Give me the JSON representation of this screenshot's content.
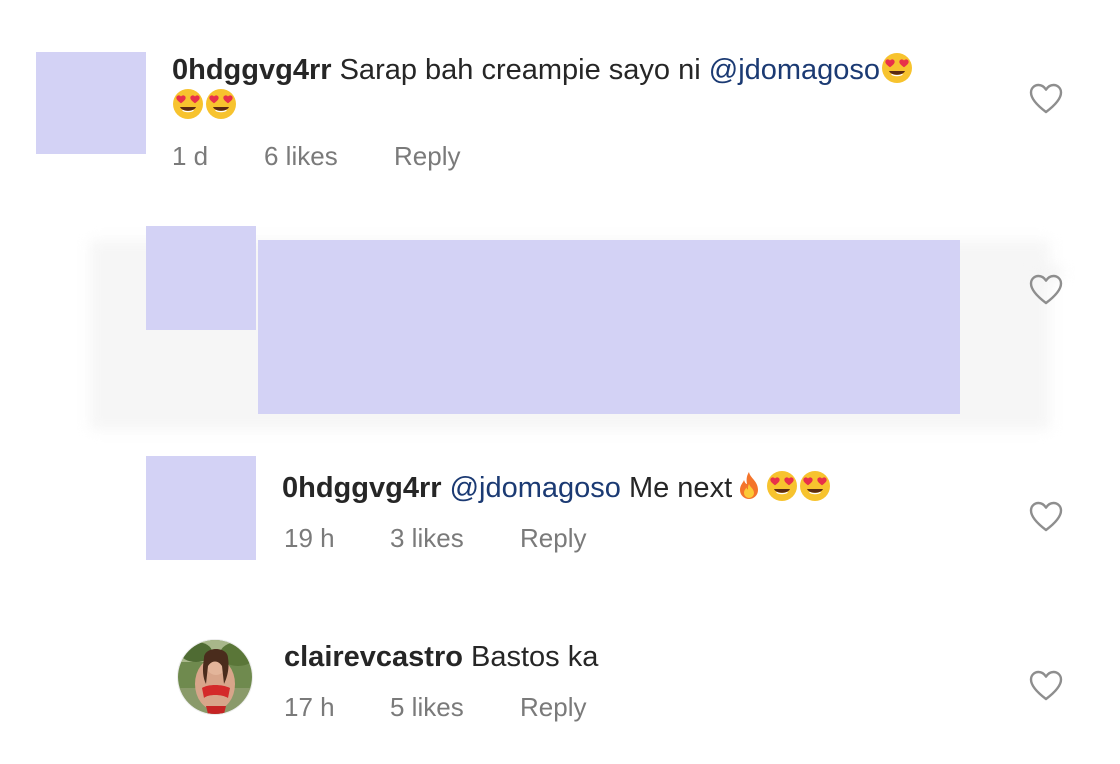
{
  "comments": [
    {
      "username": "0hdggvg4rr",
      "text_before": "Sarap bah creampie sayo ni ",
      "mention": "@jdomagoso",
      "text_after": "",
      "emojis_line1": [
        "heart-eyes"
      ],
      "emojis_line2": [
        "heart-eyes",
        "heart-eyes"
      ],
      "time": "1 d",
      "likes": "6 likes",
      "reply": "Reply",
      "avatar": "redacted"
    },
    {
      "username": "",
      "text": "",
      "avatar": "redacted",
      "content": "redacted"
    },
    {
      "username": "0hdggvg4rr",
      "mention": "@jdomagoso",
      "text_after": " Me next",
      "emojis": [
        "fire",
        "heart-eyes",
        "heart-eyes"
      ],
      "time": "19 h",
      "likes": "3 likes",
      "reply": "Reply",
      "avatar": "redacted"
    },
    {
      "username": "clairevcastro",
      "text": " Bastos ka",
      "time": "17 h",
      "likes": "5 likes",
      "reply": "Reply",
      "avatar": "photo"
    }
  ],
  "colors": {
    "redaction": "#d3d2f5",
    "mention": "#1b3a73",
    "meta": "#7a7a7a",
    "text": "#262626"
  }
}
